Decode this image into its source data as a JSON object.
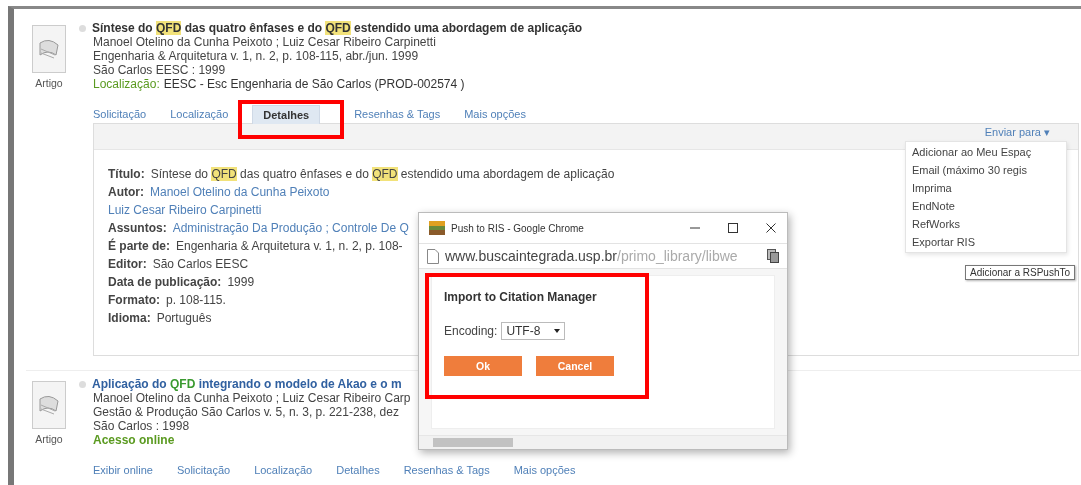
{
  "records": [
    {
      "type_label": "Artigo",
      "title": [
        {
          "text": "Síntese do ",
          "highlight": false
        },
        {
          "text": "QFD",
          "highlight": true
        },
        {
          "text": " das quatro ênfases e do ",
          "highlight": false
        },
        {
          "text": "QFD",
          "highlight": true
        },
        {
          "text": " estendido uma abordagem de aplicação",
          "highlight": false
        }
      ],
      "lines": [
        "Manoel Otelino da Cunha Peixoto ; Luiz Cesar Ribeiro Carpinetti",
        "Engenharia & Arquitetura v. 1, n. 2, p. 108-115, abr./jun. 1999",
        "São Carlos EESC : 1999"
      ],
      "availability": {
        "label": "Localização:",
        "value": "EESC - Esc Engenharia de São Carlos  (PROD-002574 )"
      },
      "tabs": [
        {
          "label": "Solicitação",
          "selected": false
        },
        {
          "label": "Localização",
          "selected": false
        },
        {
          "label": "Detalhes",
          "selected": true
        },
        {
          "label": "Resenhas & Tags",
          "selected": false
        },
        {
          "label": "Mais opções",
          "selected": false
        }
      ],
      "details": {
        "send_to": "Enviar para ▾",
        "fields": [
          {
            "label": "Título:",
            "kind": "title",
            "value": [
              {
                "text": "Síntese do ",
                "highlight": false
              },
              {
                "text": "QFD",
                "highlight": true
              },
              {
                "text": " das quatro ênfases e do ",
                "highlight": false
              },
              {
                "text": "QFD",
                "highlight": true
              },
              {
                "text": " estendido uma abordagem de aplicação",
                "highlight": false
              }
            ]
          },
          {
            "label": "Autor:",
            "kind": "links",
            "values": [
              "Manoel Otelino da Cunha Peixoto",
              "Luiz Cesar Ribeiro Carpinetti"
            ]
          },
          {
            "label": "Assuntos:",
            "kind": "links",
            "values": [
              "Administração Da Produção ; Controle De Q"
            ]
          },
          {
            "label": "É parte de:",
            "kind": "text",
            "value": "Engenharia & Arquitetura v. 1, n. 2, p. 108-"
          },
          {
            "label": "Editor:",
            "kind": "text",
            "value": "São Carlos EESC"
          },
          {
            "label": "Data de publicação:",
            "kind": "text",
            "value": "1999"
          },
          {
            "label": "Formato:",
            "kind": "text",
            "value": "p. 108-115."
          },
          {
            "label": "Idioma:",
            "kind": "text",
            "value": "Português"
          }
        ]
      }
    },
    {
      "type_label": "Artigo",
      "title": [
        {
          "text": "Aplicação do ",
          "highlight": false
        },
        {
          "text": "QFD",
          "highlight": true
        },
        {
          "text": " integrando o modelo de Akao e o m",
          "highlight": false
        }
      ],
      "lines": [
        "Manoel Otelino da Cunha Peixoto ; Luiz Cesar Ribeiro Carp",
        "Gestão & Produção São Carlos v. 5, n. 3, p. 221-238, dez",
        "São Carlos : 1998"
      ],
      "availability": {
        "label": "Acesso online"
      },
      "tabs": [
        {
          "label": "Exibir online",
          "selected": false
        },
        {
          "label": "Solicitação",
          "selected": false
        },
        {
          "label": "Localização",
          "selected": false
        },
        {
          "label": "Detalhes",
          "selected": false
        },
        {
          "label": "Resenhas & Tags",
          "selected": false
        },
        {
          "label": "Mais opções",
          "selected": false
        }
      ]
    }
  ],
  "send_menu": {
    "items": [
      "Adicionar ao Meu Espaç",
      "Email (máximo 30 regis",
      "Imprima",
      "EndNote",
      "RefWorks",
      "Exportar RIS"
    ],
    "tooltip": "Adicionar a RSPushTo"
  },
  "popup": {
    "title": "Push to RIS - Google Chrome",
    "url_host": "www.buscaintegrada.usp.br",
    "url_path": "/primo_library/libwe",
    "heading": "Import to Citation Manager",
    "encoding_label": "Encoding:",
    "encoding_value": "UTF-8",
    "buttons": [
      "Ok",
      "Cancel"
    ]
  }
}
